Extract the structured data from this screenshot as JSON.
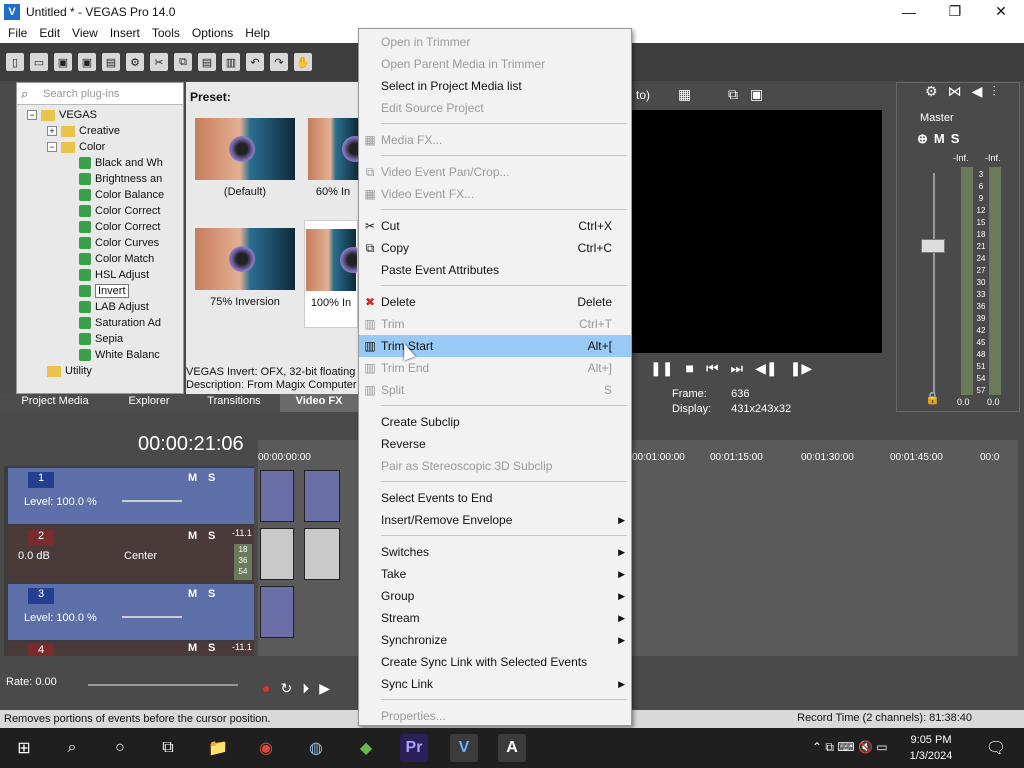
{
  "window": {
    "title": "Untitled * - VEGAS Pro 14.0",
    "icon_letter": "V",
    "min": "—",
    "max": "❐",
    "close": "✕"
  },
  "menubar": [
    "File",
    "Edit",
    "View",
    "Insert",
    "Tools",
    "Options",
    "Help"
  ],
  "plugins": {
    "search_placeholder": "Search plug-ins",
    "tree": [
      {
        "label": "VEGAS",
        "kind": "folder",
        "fold": "−"
      },
      {
        "label": "Creative",
        "kind": "folder",
        "fold": "+"
      },
      {
        "label": "Color",
        "kind": "folder",
        "fold": "−"
      },
      {
        "label": "Black and Wh",
        "kind": "fx"
      },
      {
        "label": "Brightness an",
        "kind": "fx"
      },
      {
        "label": "Color Balance",
        "kind": "fx"
      },
      {
        "label": "Color Correct",
        "kind": "fx"
      },
      {
        "label": "Color Correct",
        "kind": "fx"
      },
      {
        "label": "Color Curves",
        "kind": "fx"
      },
      {
        "label": "Color Match",
        "kind": "fx"
      },
      {
        "label": "HSL Adjust",
        "kind": "fx"
      },
      {
        "label": "Invert",
        "kind": "fx",
        "selected": true
      },
      {
        "label": "LAB Adjust",
        "kind": "fx"
      },
      {
        "label": "Saturation Ad",
        "kind": "fx"
      },
      {
        "label": "Sepia",
        "kind": "fx"
      },
      {
        "label": "White Balanc",
        "kind": "fx"
      },
      {
        "label": "Utility",
        "kind": "folder"
      }
    ],
    "preset_label": "Preset:",
    "presets": [
      {
        "label": "(Default)"
      },
      {
        "label": "60% In"
      },
      {
        "label": "75% Inversion"
      },
      {
        "label": "100% In"
      }
    ],
    "fx_info": "VEGAS Invert: OFX, 32-bit floating",
    "fx_desc": "Description: From Magix Computer"
  },
  "left_tabs": [
    {
      "label": "Project Media",
      "active": false
    },
    {
      "label": "Explorer",
      "active": false
    },
    {
      "label": "Transitions",
      "active": false
    },
    {
      "label": "Video FX",
      "active": true
    }
  ],
  "preview": {
    "mode_fragment": "to)",
    "frame_label": "Frame:",
    "frame_value": "636",
    "display_label": "Display:",
    "display_value": "431x243x32"
  },
  "master": {
    "title": "Master",
    "m_label": "M",
    "s_label": "S",
    "peak_left": "-Inf.",
    "peak_right": "-Inf.",
    "scale": [
      "3",
      "6",
      "9",
      "12",
      "15",
      "18",
      "21",
      "24",
      "27",
      "30",
      "33",
      "36",
      "39",
      "42",
      "45",
      "48",
      "51",
      "54",
      "57"
    ],
    "bottom_left": "0.0",
    "bottom_right": "0.0"
  },
  "timeline": {
    "timecode": "00:00:21:06",
    "ruler": [
      "00:00:00:00",
      "00:01:00:00",
      "00:01:15:00",
      "00:01:30:00",
      "00:01:45:00",
      "00:0"
    ],
    "tracks": [
      {
        "num": "1",
        "level": "Level: 100.0 %",
        "m": "M",
        "s": "S"
      },
      {
        "num": "2",
        "level": "0.0 dB",
        "pan": "Center",
        "m": "M",
        "s": "S",
        "db_marks": [
          "-11.1",
          "18",
          "36",
          "54"
        ]
      },
      {
        "num": "3",
        "level": "Level: 100.0 %",
        "m": "M",
        "s": "S"
      },
      {
        "num": "4",
        "m": "M",
        "s": "S",
        "db_marks": [
          "-11.1"
        ]
      }
    ],
    "rate": "Rate: 0.00"
  },
  "status": {
    "hint": "Removes portions of events before the cursor position.",
    "record_time": "Record Time (2 channels): 81:38:40"
  },
  "context_menu": {
    "items": [
      {
        "label": "Open in Trimmer",
        "enabled": false
      },
      {
        "label": "Open Parent Media in Trimmer",
        "enabled": false
      },
      {
        "label": "Select in Project Media list",
        "enabled": true
      },
      {
        "label": "Edit Source Project",
        "enabled": false
      },
      {
        "sep": true
      },
      {
        "label": "Media FX...",
        "enabled": false,
        "icon": "▦"
      },
      {
        "sep": true
      },
      {
        "label": "Video Event Pan/Crop...",
        "enabled": false,
        "icon": "⧉"
      },
      {
        "label": "Video Event FX...",
        "enabled": false,
        "icon": "▦"
      },
      {
        "sep": true
      },
      {
        "label": "Cut",
        "shortcut": "Ctrl+X",
        "enabled": true,
        "icon": "✂"
      },
      {
        "label": "Copy",
        "shortcut": "Ctrl+C",
        "enabled": true,
        "icon": "⧉"
      },
      {
        "label": "Paste Event Attributes",
        "enabled": true
      },
      {
        "sep": true
      },
      {
        "label": "Delete",
        "shortcut": "Delete",
        "enabled": true,
        "icon": "✖"
      },
      {
        "label": "Trim",
        "shortcut": "Ctrl+T",
        "enabled": false,
        "icon": "▥"
      },
      {
        "label": "Trim Start",
        "shortcut": "Alt+[",
        "enabled": true,
        "highlight": true,
        "icon": "▥"
      },
      {
        "label": "Trim End",
        "shortcut": "Alt+]",
        "enabled": false,
        "icon": "▥"
      },
      {
        "label": "Split",
        "shortcut": "S",
        "enabled": false,
        "icon": "▥"
      },
      {
        "sep": true
      },
      {
        "label": "Create Subclip",
        "enabled": true
      },
      {
        "label": "Reverse",
        "enabled": true
      },
      {
        "label": "Pair as Stereoscopic 3D Subclip",
        "enabled": false
      },
      {
        "sep": true
      },
      {
        "label": "Select Events to End",
        "enabled": true
      },
      {
        "label": "Insert/Remove Envelope",
        "enabled": true,
        "submenu": true
      },
      {
        "sep": true
      },
      {
        "label": "Switches",
        "enabled": true,
        "submenu": true
      },
      {
        "label": "Take",
        "enabled": true,
        "submenu": true
      },
      {
        "label": "Group",
        "enabled": true,
        "submenu": true
      },
      {
        "label": "Stream",
        "enabled": true,
        "submenu": true
      },
      {
        "label": "Synchronize",
        "enabled": true,
        "submenu": true
      },
      {
        "label": "Create Sync Link with Selected Events",
        "enabled": true
      },
      {
        "label": "Sync Link",
        "enabled": true,
        "submenu": true
      },
      {
        "sep": true
      },
      {
        "label": "Properties...",
        "enabled": false
      }
    ],
    "submenu_arrow": "▶"
  },
  "taskbar": {
    "start": "⊞",
    "search": "⌕",
    "cortana": "○",
    "taskview": "⧉",
    "apps": [
      "📁",
      "◉",
      "◍",
      "◆",
      "Pr",
      "V",
      "A"
    ],
    "tray": "⌃ ⧉ ⌨ 🔇 ▭",
    "time": "9:05 PM",
    "date": "1/3/2024",
    "notify": "🗨"
  },
  "colors": {
    "highlight": "#99c9f5",
    "track_blue": "#243f8f",
    "app_dark": "#4a4a4a"
  }
}
